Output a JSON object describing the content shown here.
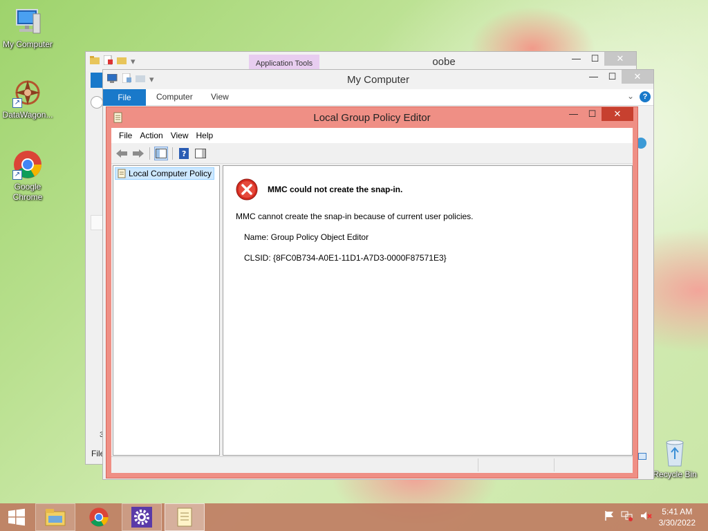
{
  "desktop": {
    "icons": [
      {
        "label": "My Computer"
      },
      {
        "label": "DataWagon..."
      },
      {
        "label": "Google Chrome"
      },
      {
        "label": "Recycle Bin"
      }
    ]
  },
  "oobe_window": {
    "title": "oobe",
    "contextual_tab": "Application Tools",
    "status_left": "File",
    "count_digit": "3"
  },
  "mycomputer_window": {
    "title": "My Computer",
    "tabs": [
      "File",
      "Computer",
      "View"
    ]
  },
  "gpe_window": {
    "title": "Local Group Policy Editor",
    "menu": [
      "File",
      "Action",
      "View",
      "Help"
    ],
    "tree_item": "Local Computer Policy",
    "error": {
      "title": "MMC could not create the snap-in.",
      "message": "MMC cannot create the snap-in because of current user policies.",
      "name_line": "Name: Group Policy Object Editor",
      "clsid_line": "CLSID: {8FC0B734-A0E1-11D1-A7D3-0000F87571E3}"
    }
  },
  "taskbar": {
    "time": "5:41 AM",
    "date": "3/30/2022"
  },
  "colors": {
    "active_frame": "#ef8f85",
    "close_button": "#c7402f",
    "file_tab": "#1979ca",
    "error_icon": "#d42a1f"
  }
}
